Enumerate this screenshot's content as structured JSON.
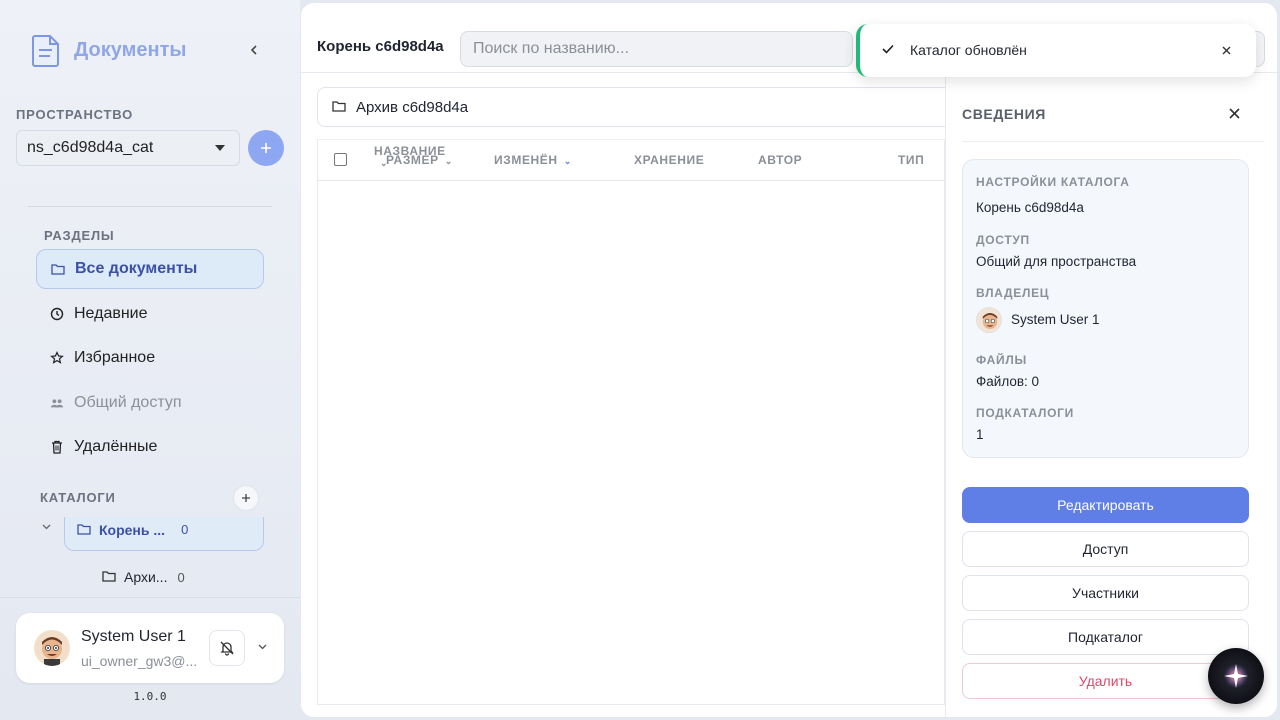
{
  "app": {
    "title": "Документы",
    "version": "1.0.0"
  },
  "sidebar": {
    "workspace_label": "ПРОСТРАНСТВО",
    "workspace_value": "ns_c6d98d4a_cat",
    "sections_label": "РАЗДЕЛЫ",
    "items": [
      {
        "label": "Все документы",
        "icon": "folder-icon",
        "active": true
      },
      {
        "label": "Недавние",
        "icon": "clock-icon"
      },
      {
        "label": "Избранное",
        "icon": "star-icon"
      },
      {
        "label": "Общий доступ",
        "icon": "people-icon",
        "disabled": true
      },
      {
        "label": "Удалённые",
        "icon": "trash-icon"
      }
    ],
    "catalogs_label": "КАТАЛОГИ",
    "tree": [
      {
        "label": "Корень ...",
        "count": "0",
        "active": true
      },
      {
        "label": "Архи...",
        "count": "0"
      }
    ],
    "user": {
      "name": "System User 1",
      "email": "ui_owner_gw3@..."
    }
  },
  "main": {
    "title": "Корень c6d98d4a",
    "search_placeholder": "Поиск по названию...",
    "folder_name": "Архив c6d98d4a",
    "columns": {
      "name": "НАЗВАНИЕ",
      "size": "РАЗМЕР",
      "modified": "ИЗМЕНЁН",
      "storage": "ХРАНЕНИЕ",
      "author": "АВТОР",
      "type": "ТИП"
    }
  },
  "details": {
    "title": "СВЕДЕНИЯ",
    "settings_label": "НАСТРОЙКИ КАТАЛОГА",
    "settings_value": "Корень c6d98d4a",
    "access_label": "ДОСТУП",
    "access_value": "Общий для пространства",
    "owner_label": "ВЛАДЕЛЕЦ",
    "owner_value": "System User 1",
    "files_label": "ФАЙЛЫ",
    "files_value": "Файлов: 0",
    "subcatalogs_label": "ПОДКАТАЛОГИ",
    "subcatalogs_value": "1",
    "buttons": {
      "edit": "Редактировать",
      "access": "Доступ",
      "members": "Участники",
      "subcatalog": "Подкаталог",
      "delete": "Удалить"
    }
  },
  "toast": {
    "text": "Каталог обновлён",
    "status_color": "#21b97a"
  },
  "colors": {
    "accent": "#5f7ee6",
    "brand": "#8fa6e8",
    "danger": "#e0486a"
  }
}
